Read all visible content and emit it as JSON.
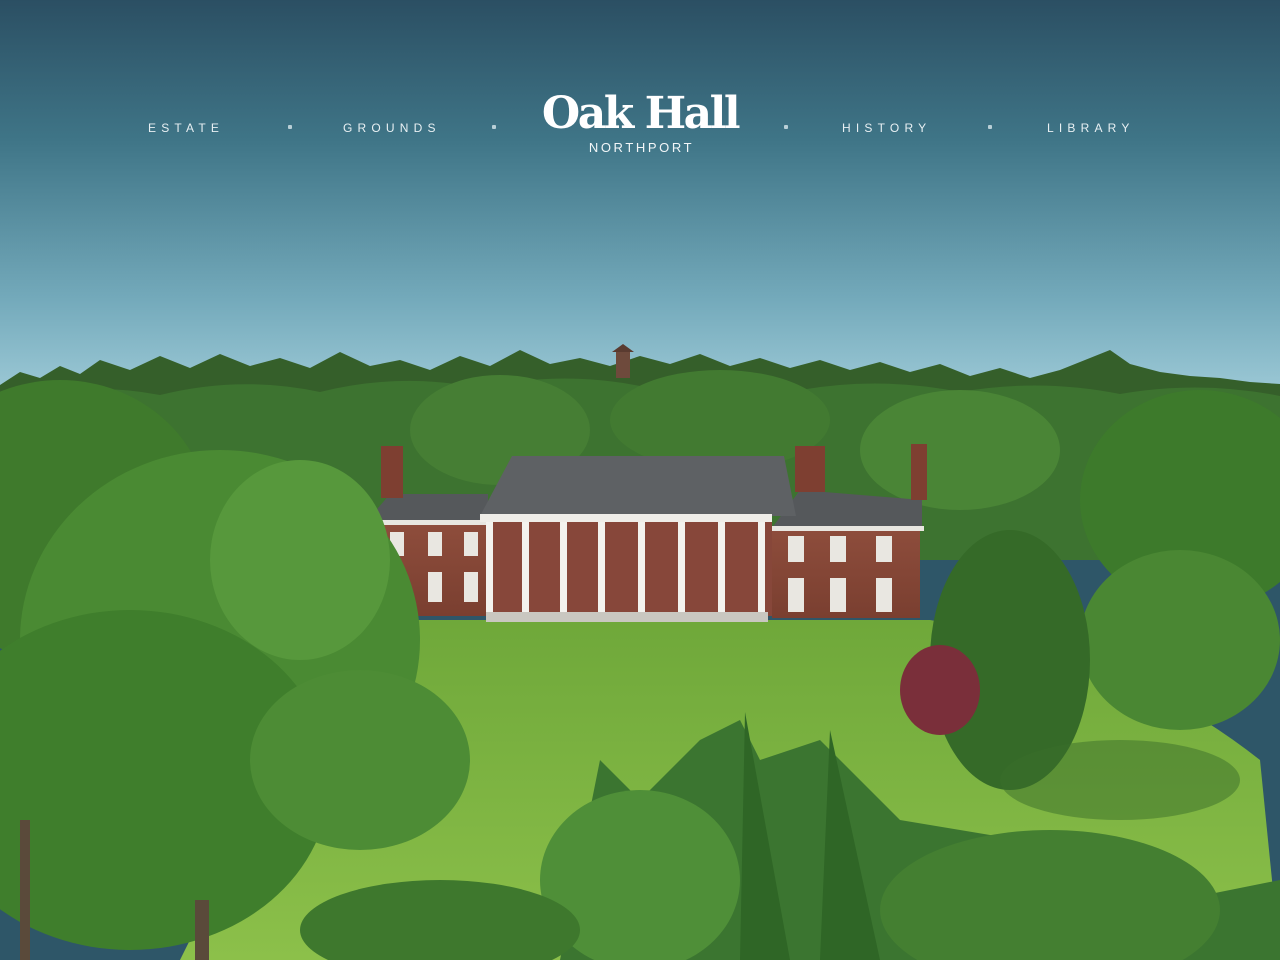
{
  "header": {
    "logo": {
      "name": "Oak Hall",
      "location": "NORTHPORT"
    },
    "nav": [
      {
        "label": "ESTATE"
      },
      {
        "label": "GROUNDS"
      },
      {
        "label": "HISTORY"
      },
      {
        "label": "LIBRARY"
      }
    ]
  },
  "colors": {
    "sky_top": "#2e5668",
    "sky_bottom": "#8fbfcf",
    "foliage": "#3f7a2c",
    "lawn": "#7fb543",
    "brick": "#8a4a3a",
    "roof": "#5c5e60",
    "text": "#ffffff"
  }
}
